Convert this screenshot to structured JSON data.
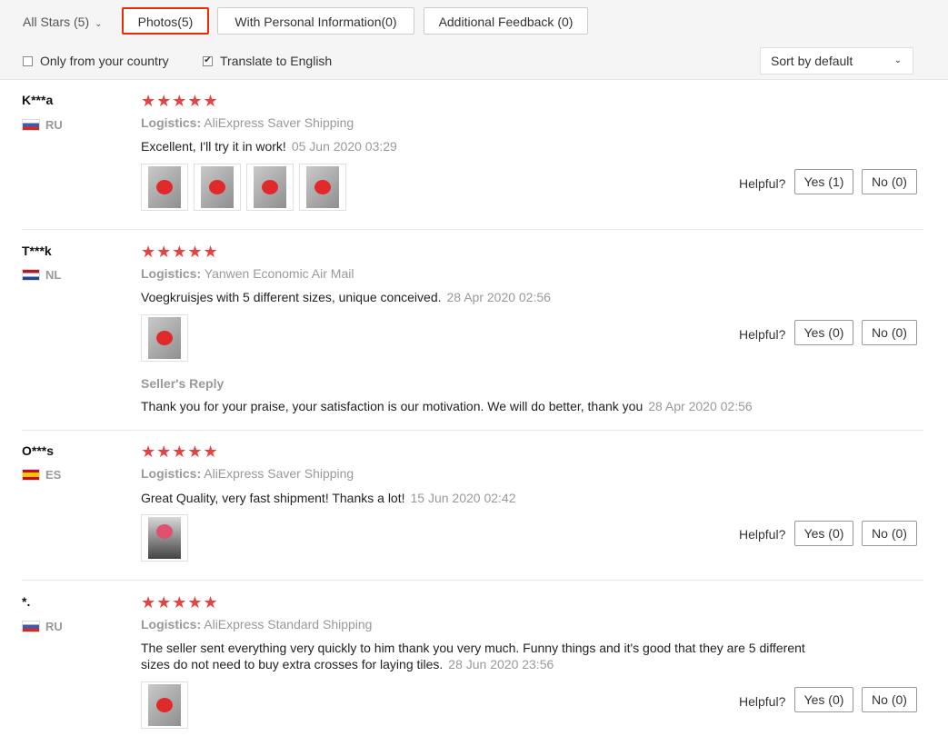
{
  "filters": {
    "stars_dropdown": "All Stars (5)",
    "tabs": [
      {
        "label": "Photos(5)",
        "active": true
      },
      {
        "label": "With Personal Information(0)",
        "active": false
      },
      {
        "label": "Additional Feedback (0)",
        "active": false
      }
    ],
    "only_country_label": "Only from your country",
    "only_country_checked": false,
    "translate_label": "Translate to English",
    "translate_checked": true,
    "sort_label": "Sort by default"
  },
  "accent_color": "#e62e04",
  "star_color": "#e64340",
  "helpful_label": "Helpful?",
  "logistics_label": "Logistics:",
  "seller_reply_label": "Seller's Reply",
  "reviews": [
    {
      "user": "K***a",
      "country": "RU",
      "stars": 5,
      "logistics": "AliExpress Saver Shipping",
      "text": "Excellent, I'll try it in work!",
      "date": "05 Jun 2020 03:29",
      "photos": 4,
      "yes": "Yes (1)",
      "no": "No (0)"
    },
    {
      "user": "T***k",
      "country": "NL",
      "stars": 5,
      "logistics": "Yanwen Economic Air Mail",
      "text": "Voegkruisjes with 5 different sizes, unique conceived.",
      "date": "28 Apr 2020 02:56",
      "photos": 1,
      "yes": "Yes (0)",
      "no": "No (0)",
      "reply": "Thank you for your praise, your satisfaction is our motivation. We will do better, thank you",
      "reply_date": "28 Apr 2020 02:56"
    },
    {
      "user": "O***s",
      "country": "ES",
      "stars": 5,
      "logistics": "AliExpress Saver Shipping",
      "text": "Great Quality, very fast shipment! Thanks a lot!",
      "date": "15 Jun 2020 02:42",
      "photos": 1,
      "yes": "Yes (0)",
      "no": "No (0)"
    },
    {
      "user": "*.",
      "country": "RU",
      "stars": 5,
      "logistics": "AliExpress Standard Shipping",
      "text_line1": "The seller sent everything very quickly to him thank you very much. Funny things and it's good that they are 5 different",
      "text_line2": "sizes do not need to buy extra crosses for laying tiles.",
      "date": "28 Jun 2020 23:56",
      "photos": 1,
      "yes": "Yes (0)",
      "no": "No (0)"
    }
  ]
}
